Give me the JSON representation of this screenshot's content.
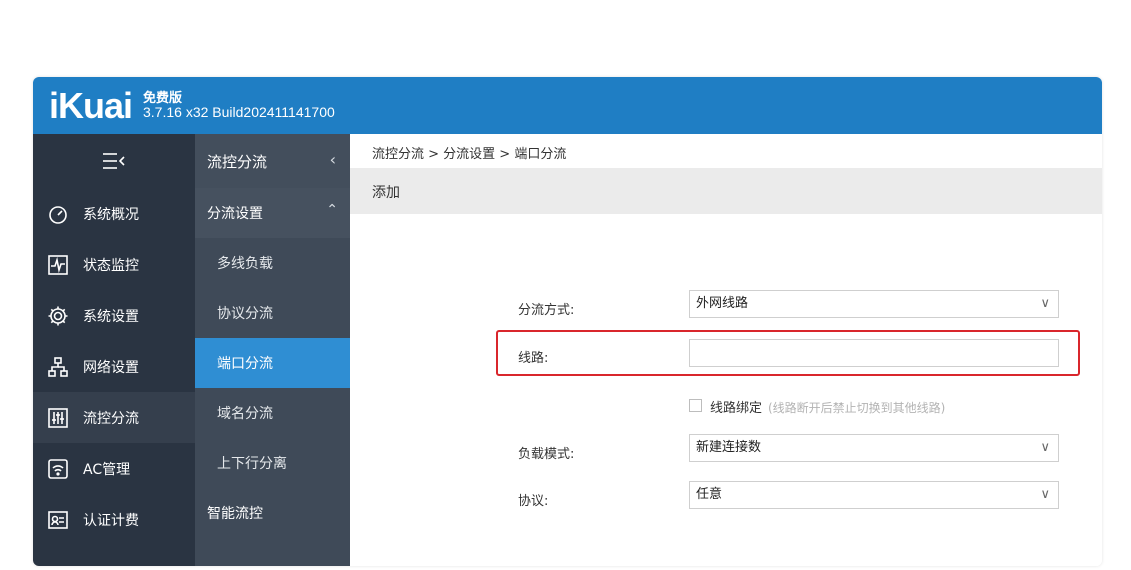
{
  "header": {
    "logo": "iKuai",
    "edition": "免费版",
    "version": "3.7.16 x32 Build202411141700"
  },
  "colors": {
    "header_bg": "#1f7ec4",
    "sidebar_bg": "#2a3442",
    "submenu_bg": "#3f4a58",
    "selected_bg": "#2f8ed3",
    "highlight_border": "#d9262c"
  },
  "sidebar": {
    "toggle_icon": "menu-collapse-icon",
    "items": [
      {
        "label": "系统概况",
        "icon": "dashboard-icon"
      },
      {
        "label": "状态监控",
        "icon": "monitor-icon"
      },
      {
        "label": "系统设置",
        "icon": "gear-icon"
      },
      {
        "label": "网络设置",
        "icon": "network-icon"
      },
      {
        "label": "流控分流",
        "icon": "equalizer-icon",
        "active": true
      },
      {
        "label": "AC管理",
        "icon": "wifi-icon"
      },
      {
        "label": "认证计费",
        "icon": "auth-icon"
      }
    ]
  },
  "submenu": {
    "title": "流控分流",
    "group": "分流设置",
    "items": [
      "多线负载",
      "协议分流",
      "端口分流",
      "域名分流",
      "上下行分离"
    ],
    "selected": "端口分流",
    "next_group": "智能流控"
  },
  "content": {
    "breadcrumb": "流控分流 > 分流设置 > 端口分流",
    "panel_title": "添加",
    "form": {
      "mode_label": "分流方式:",
      "mode_value": "外网线路",
      "line_label": "线路:",
      "line_value": "",
      "bind_label": "线路绑定",
      "bind_hint": "(线路断开后禁止切换到其他线路)",
      "load_label": "负载模式:",
      "load_value": "新建连接数",
      "protocol_label": "协议:",
      "protocol_value": "任意"
    }
  }
}
